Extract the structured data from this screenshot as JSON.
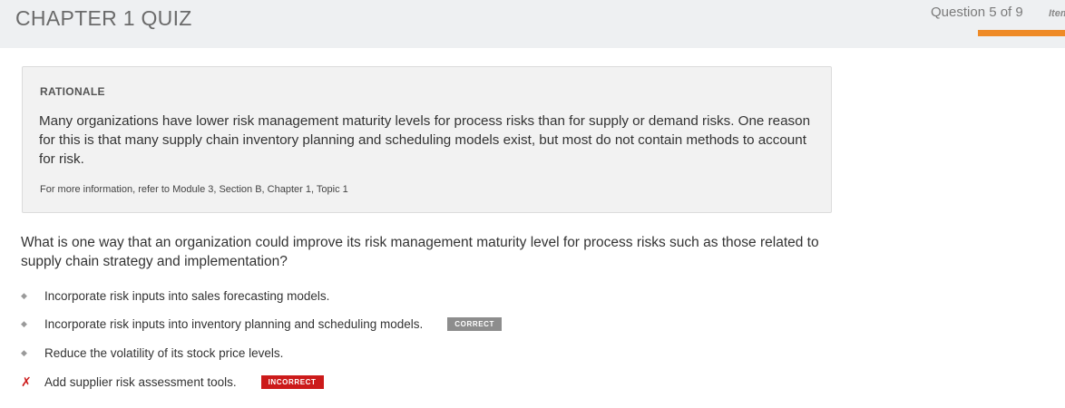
{
  "header": {
    "title": "CHAPTER 1 QUIZ",
    "progress_label": "Question 5 of 9",
    "items_label": "Items",
    "progress_fraction": 0.5556,
    "accent_color": "#ee8a26"
  },
  "rationale": {
    "heading": "RATIONALE",
    "body": "Many organizations have lower risk management maturity levels for process risks than for supply or demand risks. One reason for this is that many supply chain inventory planning and scheduling models exist, but most do not contain methods to account for risk.",
    "reference": "For more information, refer to Module 3, Section B, Chapter 1, Topic 1"
  },
  "question": {
    "text": "What is one way that an organization could improve its risk management maturity level for process risks such as those related to supply chain strategy and implementation?"
  },
  "options": [
    {
      "text": "Incorporate risk inputs into sales forecasting models.",
      "marker": "diamond-icon",
      "badge": ""
    },
    {
      "text": "Incorporate risk inputs into inventory planning and scheduling models.",
      "marker": "diamond-icon",
      "badge": "CORRECT"
    },
    {
      "text": "Reduce the volatility of its stock price levels.",
      "marker": "diamond-icon",
      "badge": ""
    },
    {
      "text": "Add supplier risk assessment tools.",
      "marker": "x-icon",
      "badge": "INCORRECT"
    }
  ],
  "colors": {
    "correct_badge": "#8d8d8d",
    "incorrect_badge": "#cc1a1a"
  }
}
